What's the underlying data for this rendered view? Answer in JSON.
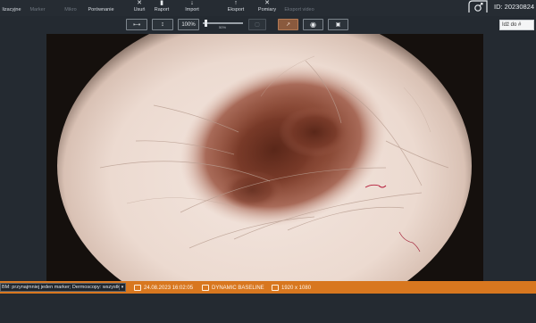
{
  "ribbon": {
    "items": [
      {
        "label": "lizacyjne",
        "icon": "",
        "enabled": true
      },
      {
        "label": "Marker",
        "icon": "marker-icon",
        "enabled": false
      },
      {
        "label": "Mikro",
        "icon": "micro-icon",
        "enabled": false
      },
      {
        "label": "Porównanie",
        "icon": "compare-icon",
        "enabled": true
      },
      {
        "label": "Usuń",
        "icon": "delete-icon",
        "enabled": true
      },
      {
        "label": "Raport",
        "icon": "report-icon",
        "enabled": true
      },
      {
        "label": "Import",
        "icon": "import-icon",
        "enabled": true
      },
      {
        "label": "Eksport",
        "icon": "export-icon",
        "enabled": true
      },
      {
        "label": "Pomiary",
        "icon": "measure-icon",
        "enabled": true
      },
      {
        "label": "Eksport video",
        "icon": "video-export-icon",
        "enabled": false
      }
    ],
    "patient_id": "ID: 20230824"
  },
  "toolbar": {
    "zoom_label": "100%",
    "zoom_slider_pct": "50%",
    "zoom_slider_level": 0.05,
    "search_value": "Idź do #"
  },
  "status": {
    "filter_text": "BM: przynajmniej jeden marker; Dermoscopy: wszystko",
    "date": "24.08.2023 16:02:05",
    "mode": "DYNAMIC BASELINE",
    "resolution": "1920 x 1080",
    "accent_color": "#d8771f"
  }
}
